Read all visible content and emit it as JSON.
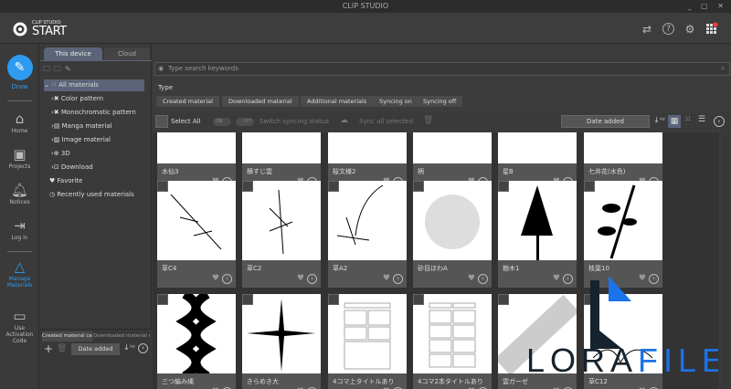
{
  "window": {
    "title": "CLIP STUDIO"
  },
  "header": {
    "logo_small": "CLIP STUDIO",
    "logo_big": "START",
    "icons": [
      "sync-icon",
      "help-icon",
      "gear-icon",
      "apps-grid-icon"
    ],
    "notification_color": "#ff3b3b"
  },
  "nav": {
    "accent": "#2e9bf0",
    "items": [
      {
        "label": "Draw",
        "icon": "brush-icon"
      },
      {
        "label": "Home",
        "icon": "home-icon"
      },
      {
        "label": "Projects",
        "icon": "projects-icon"
      },
      {
        "label": "Notices",
        "icon": "bell-icon"
      },
      {
        "label": "Log in",
        "icon": "login-icon"
      },
      {
        "label": "Manage Materials",
        "icon": "shapes-icon"
      },
      {
        "label": "Use Activation Code",
        "icon": "ticket-icon"
      }
    ]
  },
  "tree": {
    "tabs": [
      "This device",
      "Cloud"
    ],
    "items": [
      "All materials",
      "Color pattern",
      "Monochromatic pattern",
      "Manga material",
      "Image material",
      "3D",
      "Download",
      "Favorite",
      "Recently used materials"
    ],
    "bottom_tabs": [
      "Created material ca...",
      "Downloaded material ca..."
    ],
    "sort": "Date added"
  },
  "main": {
    "search_placeholder": "Type search keywords",
    "type_label": "Type",
    "chips": [
      "Created material",
      "Downloaded material",
      "Additional materials",
      "Syncing on",
      "Syncing off"
    ],
    "select_all": "Select All",
    "on": "ON",
    "off": "OFF",
    "switch_sync": "Switch syncing status",
    "sync_all": "Sync all selected",
    "sort": "Date added",
    "cards": [
      [
        "水仙3",
        "横すじ雲",
        "桜文様2",
        "柄",
        "星B",
        "七弁花(水色)"
      ],
      [
        "草C4",
        "草C2",
        "草A2",
        "砂目ほわA",
        "樹木1",
        "枝葉10"
      ],
      [
        "三つ編み縄",
        "きらめき大",
        "4コマ上タイトルあり",
        "4コマ2本タイトルあり",
        "雲ガーゼ",
        "草C12"
      ]
    ]
  },
  "watermark": {
    "text_dark": "LORA",
    "text_blue": "FILE"
  }
}
